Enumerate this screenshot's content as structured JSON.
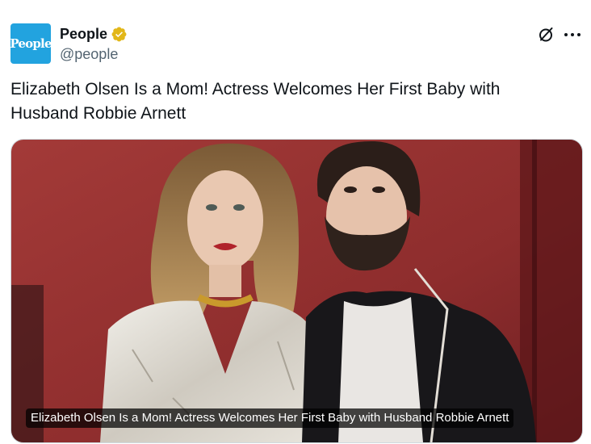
{
  "author": {
    "avatar_text": "People",
    "display_name": "People",
    "handle": "@people",
    "verified_badge_color": "#e2b719",
    "avatar_color": "#22a3df"
  },
  "actions": {
    "grok_icon": "grok-icon",
    "more_icon": "more-icon"
  },
  "tweet": {
    "text": "Elizabeth Olsen Is a Mom! Actress Welcomes Her First Baby with Husband Robbie Arnett"
  },
  "card": {
    "caption": "Elizabeth Olsen Is a Mom! Actress Welcomes Her First Baby with Husband Robbie Arnett"
  }
}
